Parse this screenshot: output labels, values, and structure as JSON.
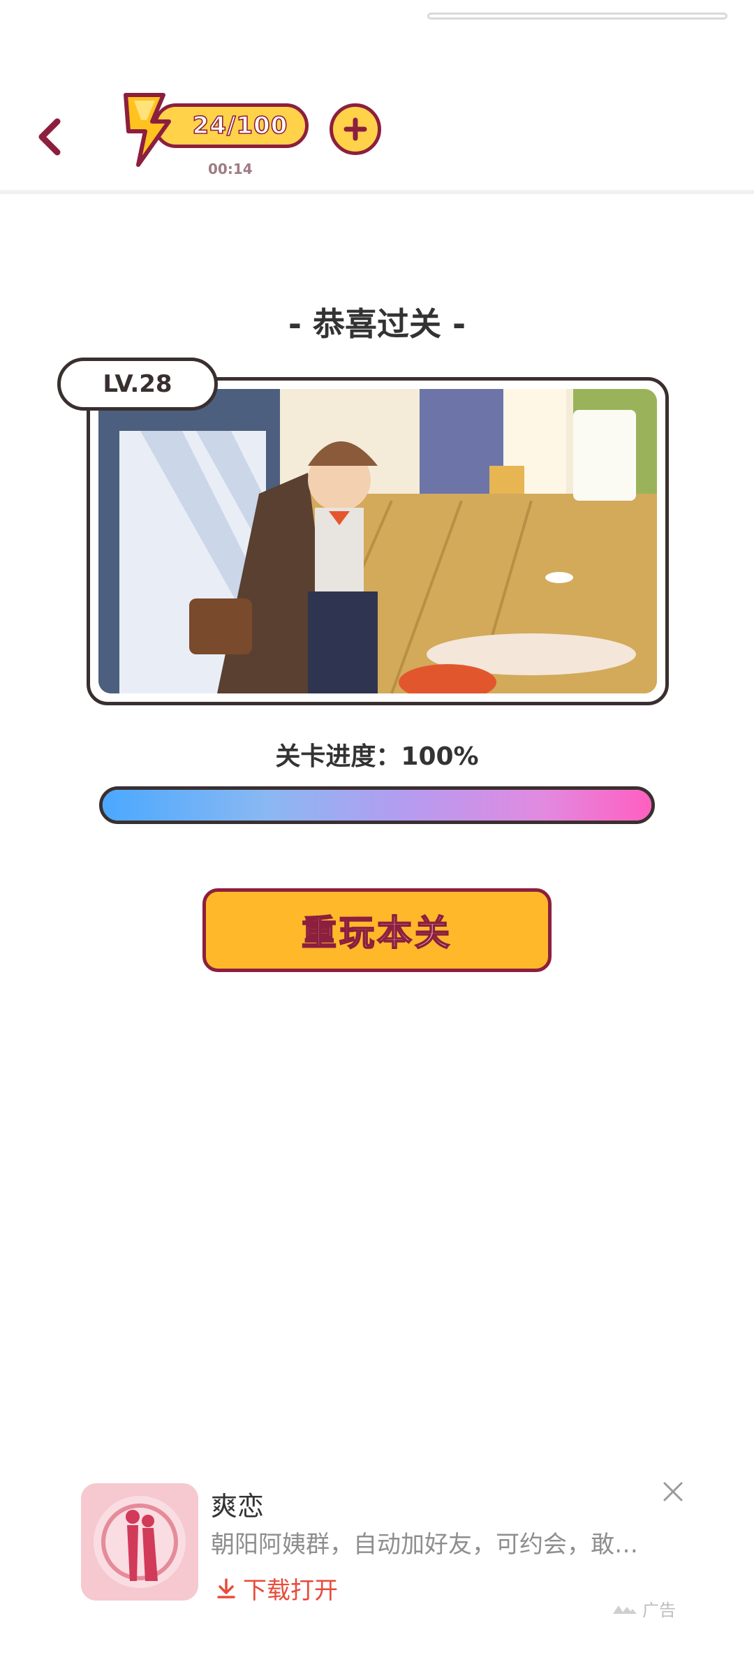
{
  "header": {
    "back_icon": "chevron-left-icon",
    "energy": {
      "value": "24/100",
      "timer": "00:14",
      "icon": "lightning-bolt-icon"
    },
    "add_icon": "plus-circle-icon"
  },
  "result": {
    "title": "- 恭喜过关 -",
    "level": "LV.28",
    "progress_label": "关卡进度：100%",
    "progress_fraction": 1.0,
    "replay_label": "重玩本关"
  },
  "ad": {
    "app_name": "爽恋",
    "description": "朝阳阿姨群，自动加好友，可约会，敢…",
    "cta": "下载打开",
    "label": "广告"
  },
  "colors": {
    "accent_dark": "#8c1f3e",
    "button_yellow": "#ffb82a",
    "energy_yellow": "#ffd24a",
    "ad_cta_red": "#e84b3a"
  }
}
